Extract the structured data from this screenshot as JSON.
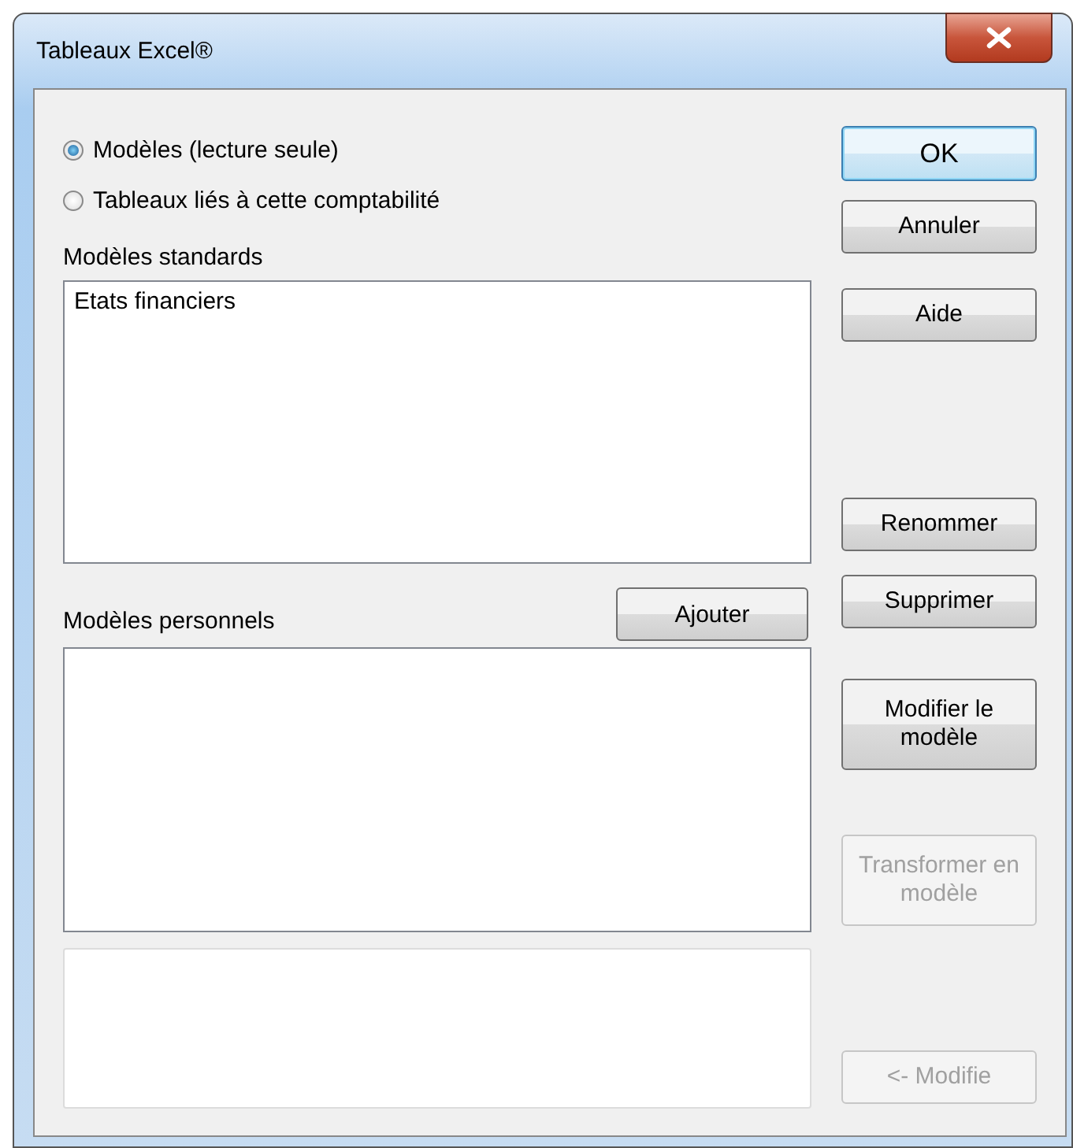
{
  "window": {
    "title": "Tableaux Excel®"
  },
  "radios": [
    {
      "label": "Modèles (lecture seule)",
      "selected": true
    },
    {
      "label": "Tableaux liés à cette comptabilité",
      "selected": false
    }
  ],
  "standard_models": {
    "label": "Modèles standards",
    "items": [
      "Etats financiers"
    ]
  },
  "personal_models": {
    "label": "Modèles personnels",
    "add_button": "Ajouter"
  },
  "buttons": [
    {
      "label": "OK",
      "default": true,
      "disabled": false
    },
    {
      "label": "Annuler",
      "default": false,
      "disabled": false
    },
    {
      "label": "Aide",
      "default": false,
      "disabled": false
    },
    {
      "label": "Renommer",
      "default": false,
      "disabled": false
    },
    {
      "label": "Supprimer",
      "default": false,
      "disabled": false
    },
    {
      "label": "Modifier le modèle",
      "default": false,
      "disabled": false
    },
    {
      "label": "Transformer en modèle",
      "default": false,
      "disabled": true
    },
    {
      "label": "<- Modifie",
      "default": false,
      "disabled": true
    }
  ]
}
